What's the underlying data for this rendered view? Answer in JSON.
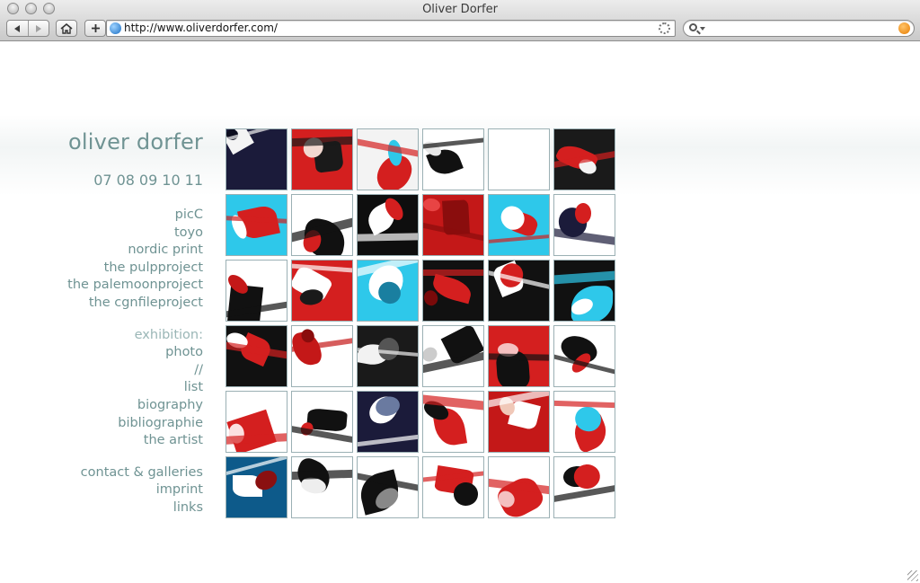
{
  "browser": {
    "window_title": "Oliver Dorfer",
    "url": "http://www.oliverdorfer.com/",
    "icons": [
      "back-arrow-icon",
      "forward-arrow-icon",
      "home-icon",
      "add-bookmark-icon",
      "globe-icon",
      "loading-spinner-icon",
      "search-icon",
      "snapback-icon"
    ]
  },
  "site": {
    "title": "oliver dorfer",
    "years": [
      "07",
      "08",
      "09",
      "10",
      "11"
    ],
    "projects": [
      "picC",
      "toyo",
      "nordic print",
      "the pulpproject",
      "the palemoonproject",
      "the cgnfileproject"
    ],
    "exhibition": {
      "label": "exhibition:",
      "photo": "photo",
      "separator": "//",
      "list": "list"
    },
    "info_links": [
      "biography",
      "bibliographie",
      "the artist"
    ],
    "contact_links": [
      "contact & galleries",
      "imprint",
      "links"
    ],
    "colors": {
      "text": "#6f9393",
      "muted": "#9ab6b6",
      "thumb_border": "#9bb0b4",
      "accent_red": "#d41f1f",
      "accent_cyan": "#2ec8ea"
    }
  },
  "gallery": {
    "rows": 6,
    "columns": 6,
    "thumbnail_count": 36
  }
}
